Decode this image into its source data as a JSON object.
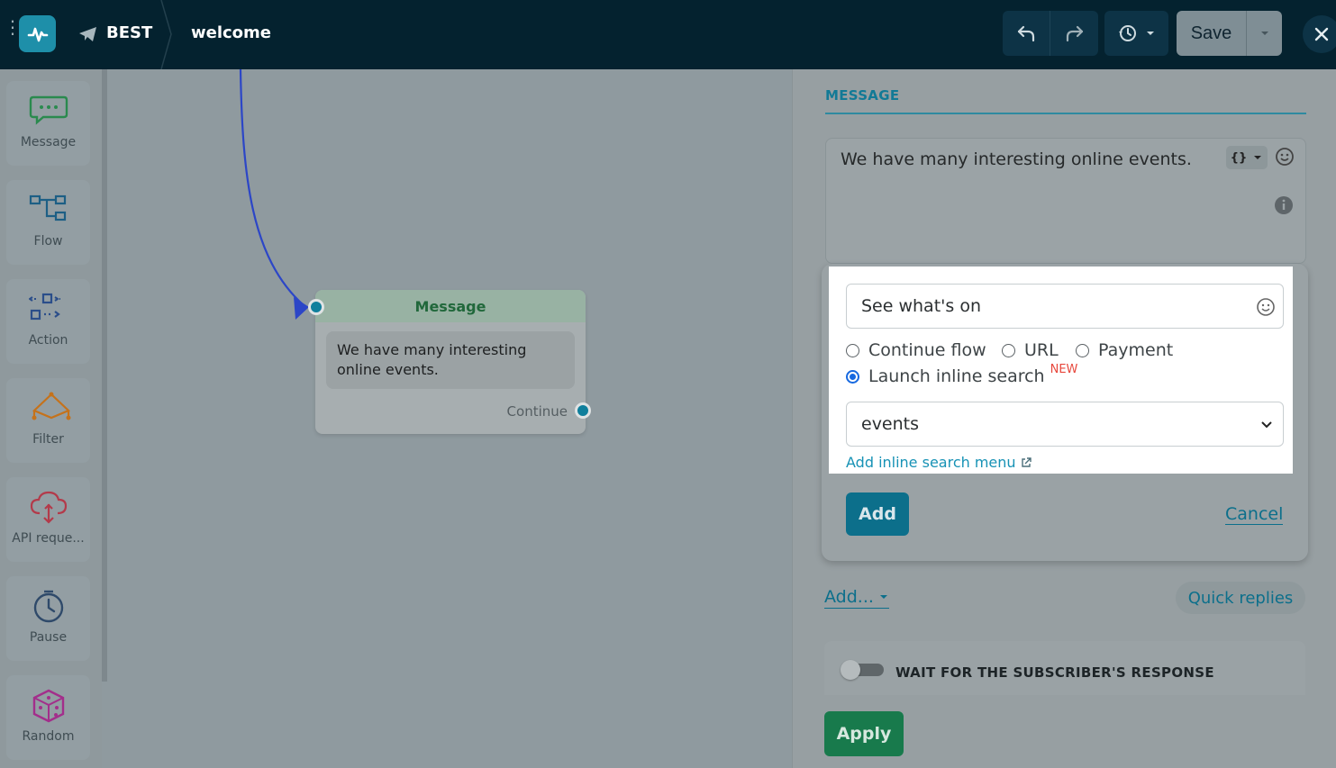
{
  "header": {
    "bot_name": "BEST",
    "flow_name": "welcome",
    "save_label": "Save"
  },
  "toolbox": {
    "items": [
      {
        "label": "Message",
        "icon": "chat-bubble-icon",
        "color": "#2a9a52"
      },
      {
        "label": "Flow",
        "icon": "flow-icon",
        "color": "#1d6f9a"
      },
      {
        "label": "Action",
        "icon": "action-icon",
        "color": "#2b4e8a"
      },
      {
        "label": "Filter",
        "icon": "filter-icon",
        "color": "#c5721b"
      },
      {
        "label": "API reque...",
        "icon": "cloud-api-icon",
        "color": "#b33a4a"
      },
      {
        "label": "Pause",
        "icon": "clock-icon",
        "color": "#2f4a6a"
      },
      {
        "label": "Random",
        "icon": "dice-icon",
        "color": "#a32e8b"
      }
    ]
  },
  "node": {
    "title": "Message",
    "text": "We have many interesting online events.",
    "continue_label": "Continue"
  },
  "panel": {
    "title": "MESSAGE",
    "message_text": "We have many interesting online events.",
    "button_editor": {
      "button_text": "See what's on",
      "options": [
        "Continue flow",
        "URL",
        "Payment",
        "Launch inline search"
      ],
      "selected_option": "Launch inline search",
      "new_badge": "NEW",
      "selected_menu": "events",
      "add_menu_link": "Add inline search menu",
      "add_label": "Add",
      "cancel_label": "Cancel"
    },
    "add_dropdown_label": "Add...",
    "quick_replies_label": "Quick replies",
    "wait_label": "WAIT FOR THE SUBSCRIBER'S RESPONSE",
    "apply_label": "Apply"
  },
  "colors": {
    "topbar": "#04222f",
    "accent": "#0c6f8b",
    "apply": "#187a4c",
    "radio_selected": "#1769e0",
    "new_badge": "#e7473c",
    "connector": "#2c46c7"
  }
}
